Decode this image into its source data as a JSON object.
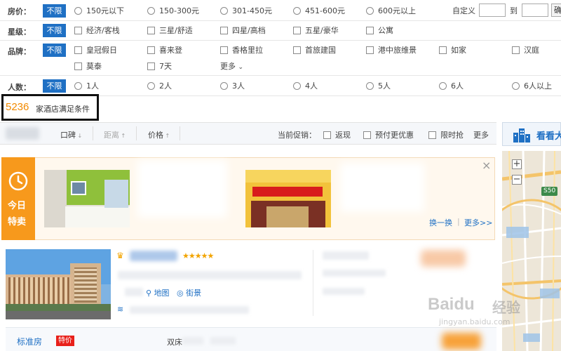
{
  "filters": {
    "price": {
      "label": "房价：",
      "unlimited": "不限",
      "options": [
        "150元以下",
        "150-300元",
        "301-450元",
        "451-600元",
        "600元以上"
      ],
      "custom_label": "自定义",
      "to_label": "到",
      "confirm_label": "确"
    },
    "star": {
      "label": "星级：",
      "unlimited": "不限",
      "options": [
        "经济/客栈",
        "三星/舒适",
        "四星/高档",
        "五星/豪华",
        "公寓"
      ]
    },
    "brand": {
      "label": "品牌：",
      "unlimited": "不限",
      "options_row1": [
        "皇冠假日",
        "喜来登",
        "香格里拉",
        "首旅建国",
        "港中旅维景",
        "如家",
        "汉庭"
      ],
      "options_row2": [
        "莫泰",
        "7天"
      ],
      "more_label": "更多"
    },
    "guests": {
      "label": "人数：",
      "unlimited": "不限",
      "options": [
        "1人",
        "2人",
        "3人",
        "4人",
        "5人",
        "6人",
        "6人以上"
      ]
    }
  },
  "result": {
    "count": "5236",
    "text": "家酒店满足条件"
  },
  "sortbar": {
    "sort_reputation": "口碑",
    "sort_distance": "距离",
    "sort_price": "价格",
    "promo_label": "当前促销：",
    "promo_options": [
      "返现",
      "预付更优惠",
      "限时抢"
    ],
    "more_label": "更多"
  },
  "map": {
    "header_label": "看看大",
    "zoom_in": "+",
    "zoom_out": "−",
    "road_label": "S50"
  },
  "promo_panel": {
    "badge_top": "今日",
    "badge_bottom": "特卖",
    "refresh_label": "换一换",
    "more_label": "更多>>",
    "close_label": "×"
  },
  "hotel": {
    "map_link": "地图",
    "street_view_link": "街景",
    "stars": "★★★★★"
  },
  "room": {
    "type_label": "标准房",
    "tag_label": "特价",
    "bed_label": "双床"
  },
  "watermark": {
    "logo": "Baidu",
    "brand": "经验",
    "url": "jingyan.baidu.com"
  },
  "colors": {
    "accent_blue": "#1f70c4",
    "promo_orange": "#f7991c",
    "promo_bg": "#fff8ee",
    "tag_red": "#e8201a",
    "result_orange": "#f28a00"
  }
}
